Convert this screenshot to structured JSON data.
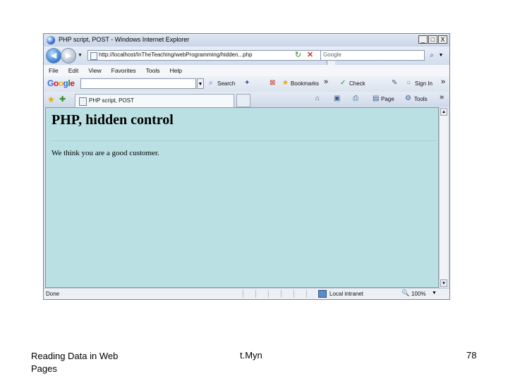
{
  "window": {
    "title": "PHP script, POST - Windows Internet Explorer",
    "controls": [
      "_",
      "□",
      "X"
    ]
  },
  "address_bar": {
    "url": "http://localhost/InTheTeaching/webProgramming/hidden...php",
    "search_placeholder": "Google"
  },
  "menu": {
    "items": [
      "File",
      "Edit",
      "View",
      "Favorites",
      "Tools",
      "Help"
    ]
  },
  "google_toolbar": {
    "logo": "Google",
    "search_label": "Search",
    "bookmarks_label": "Bookmarks",
    "more_chevron": "»",
    "check_label": "Check",
    "signin_label": "Sign In",
    "right_chevron": "»"
  },
  "tabs": {
    "active_label": "PHP script, POST"
  },
  "command_bar": {
    "page_label": "Page",
    "tools_label": "Tools",
    "more_chevron": "»"
  },
  "page": {
    "heading": "PHP, hidden control",
    "message": "We think you are a good customer.",
    "background": "#bae0e4"
  },
  "status_bar": {
    "status": "Done",
    "zone": "Local intranet",
    "zoom": "100%"
  },
  "slide_footer": {
    "left": "Reading Data in Web Pages",
    "center": "t.Myn",
    "right": "78"
  }
}
